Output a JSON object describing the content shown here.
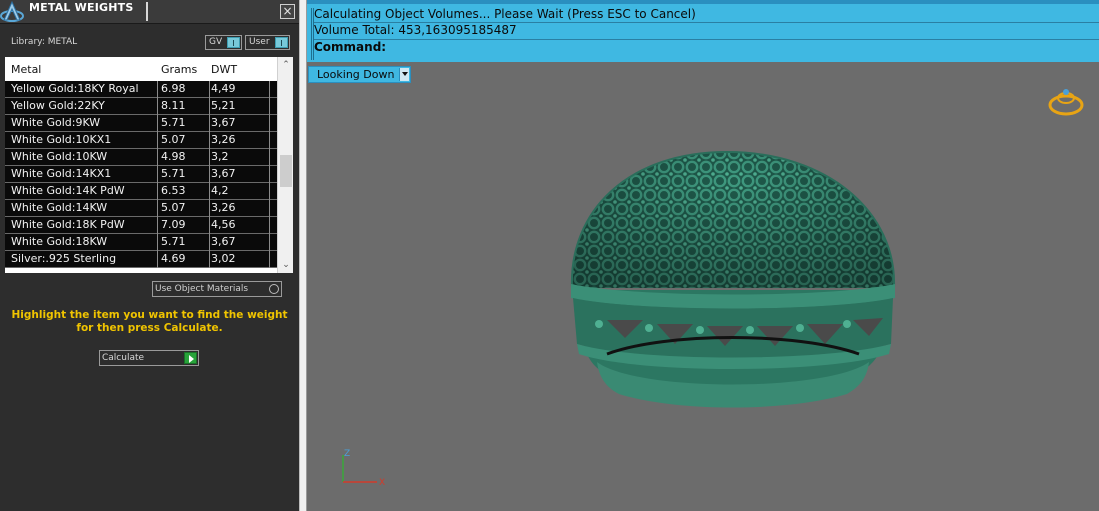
{
  "panel": {
    "title": "METAL WEIGHTS",
    "close_label": "×",
    "library_label": "Library: METAL",
    "toggle_gv": "GV",
    "toggle_user": "User",
    "table": {
      "headers": [
        "Metal",
        "Grams",
        "DWT"
      ],
      "rows": [
        [
          "Yellow Gold:18KY Royal",
          "6.98",
          "4,49"
        ],
        [
          "Yellow Gold:22KY",
          "8.11",
          "5,21"
        ],
        [
          "White Gold:9KW",
          "5.71",
          "3,67"
        ],
        [
          "White Gold:10KX1",
          "5.07",
          "3,26"
        ],
        [
          "White Gold:10KW",
          "4.98",
          "3,2"
        ],
        [
          "White Gold:14KX1",
          "5.71",
          "3,67"
        ],
        [
          "White Gold:14K PdW",
          "6.53",
          "4,2"
        ],
        [
          "White Gold:14KW",
          "5.07",
          "3,26"
        ],
        [
          "White Gold:18K PdW",
          "7.09",
          "4,56"
        ],
        [
          "White Gold:18KW",
          "5.71",
          "3,67"
        ],
        [
          "Silver:.925 Sterling",
          "4.69",
          "3,02"
        ]
      ]
    },
    "use_object_materials": "Use Object Materials",
    "hint": "Highlight the item you want to find the weight for then press Calculate.",
    "calculate_label": "Calculate"
  },
  "command": {
    "line1": "Calculating Object Volumes... Please Wait (Press ESC to Cancel)",
    "line2": "Volume Total: 453,163095185487",
    "line3": "Command:"
  },
  "viewport": {
    "view_label": "Looking Down",
    "axis_z": "Z",
    "axis_x": "X"
  },
  "colors": {
    "panel_bg": "#2d2d2d",
    "accent_blue": "#3fb8e2",
    "hint_yellow": "#f0c400",
    "ring_green": "#2f7a66",
    "viewport_bg": "#6c6c6c"
  }
}
